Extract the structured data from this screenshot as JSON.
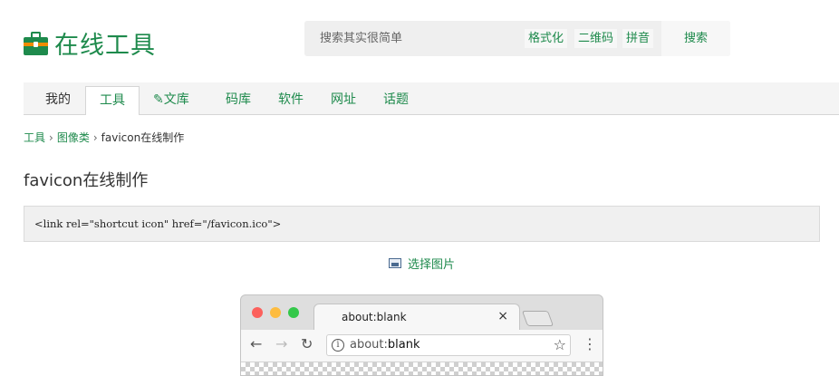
{
  "header": {
    "logo_text": "在线工具",
    "search": {
      "placeholder": "搜索其实很简单",
      "tags": [
        "格式化",
        "二维码",
        "拼音"
      ],
      "button_label": "搜索"
    }
  },
  "nav": {
    "items": [
      {
        "label": "我的"
      },
      {
        "label": "工具"
      },
      {
        "label": "文库"
      },
      {
        "label": "码库"
      },
      {
        "label": "软件"
      },
      {
        "label": "网址"
      },
      {
        "label": "话题"
      }
    ],
    "active_index": 1
  },
  "breadcrumb": {
    "items": [
      "工具",
      "图像类",
      "favicon在线制作"
    ],
    "separator": "›"
  },
  "page": {
    "title": "favicon在线制作",
    "code_snippet": "<link rel=\"shortcut icon\" href=\"/favicon.ico\">",
    "select_image_label": "选择图片"
  },
  "browser_mock": {
    "tab_title": "about:blank",
    "url_prefix": "about:",
    "url_main": "blank",
    "close_glyph": "×",
    "back_glyph": "←",
    "forward_glyph": "→",
    "reload_glyph": "↻",
    "star_glyph": "☆",
    "menu_glyph": "⋮"
  },
  "colors": {
    "accent": "#1e8a4c",
    "logo_band": "#f08c00",
    "traffic_red": "#fc605c",
    "traffic_yellow": "#fdbc40",
    "traffic_green": "#34c84a"
  }
}
